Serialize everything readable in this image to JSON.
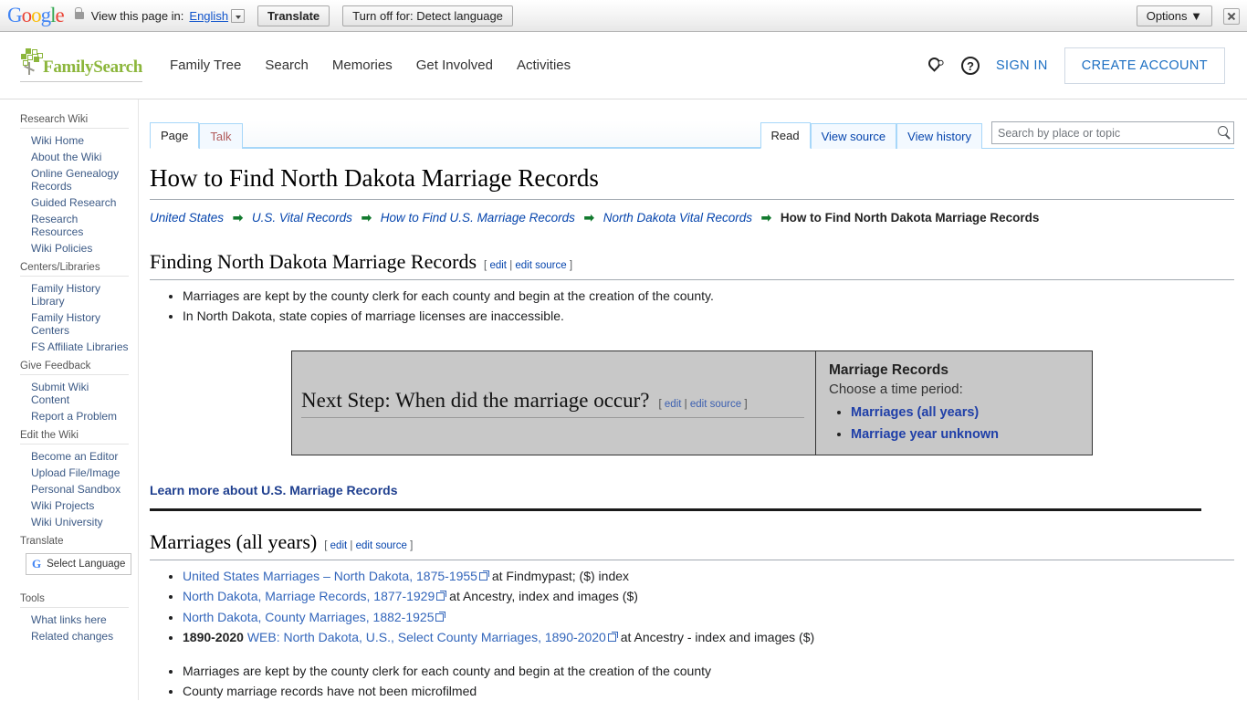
{
  "translate_bar": {
    "logo": "Google",
    "lock_icon": "lock-icon",
    "label": "View this page in:",
    "language": "English",
    "translate_button": "Translate",
    "turn_off_button": "Turn off for: Detect language",
    "options_button": "Options ▼",
    "close_icon": "close-icon"
  },
  "header": {
    "brand": "FamilySearch",
    "nav": [
      {
        "label": "Family Tree"
      },
      {
        "label": "Search"
      },
      {
        "label": "Memories"
      },
      {
        "label": "Get Involved"
      },
      {
        "label": "Activities"
      }
    ],
    "location_icon": "location-pin-icon",
    "help_icon": "help-circle-icon",
    "help_glyph": "?",
    "sign_in": "SIGN IN",
    "create_account": "CREATE ACCOUNT"
  },
  "sidebar": {
    "groups": [
      {
        "heading": "Research Wiki",
        "items": [
          {
            "label": "Wiki Home"
          },
          {
            "label": "About the Wiki"
          },
          {
            "label": "Online Genealogy Records"
          },
          {
            "label": "Guided Research"
          },
          {
            "label": "Research Resources"
          },
          {
            "label": "Wiki Policies"
          }
        ]
      },
      {
        "heading": "Centers/Libraries",
        "items": [
          {
            "label": "Family History Library"
          },
          {
            "label": "Family History Centers"
          },
          {
            "label": "FS Affiliate Libraries"
          }
        ]
      },
      {
        "heading": "Give Feedback",
        "items": [
          {
            "label": "Submit Wiki Content"
          },
          {
            "label": "Report a Problem"
          }
        ]
      },
      {
        "heading": "Edit the Wiki",
        "items": [
          {
            "label": "Become an Editor"
          },
          {
            "label": "Upload File/Image"
          },
          {
            "label": "Personal Sandbox"
          },
          {
            "label": "Wiki Projects"
          },
          {
            "label": "Wiki University"
          }
        ]
      }
    ],
    "translate_heading": "Translate",
    "select_language": "Select Language",
    "google_g": "G",
    "tools_heading": "Tools",
    "tools": [
      {
        "label": "What links here"
      },
      {
        "label": "Related changes"
      }
    ]
  },
  "tabs": {
    "left": [
      {
        "label": "Page",
        "selected": true
      },
      {
        "label": "Talk",
        "selected": false
      }
    ],
    "right": [
      {
        "label": "Read",
        "selected": true
      },
      {
        "label": "View source",
        "selected": false
      },
      {
        "label": "View history",
        "selected": false
      }
    ]
  },
  "search": {
    "placeholder": "Search by place or topic",
    "value": "",
    "icon": "search-icon"
  },
  "page": {
    "title": "How to Find North Dakota Marriage Records",
    "breadcrumb": [
      {
        "label": "United States",
        "current": false
      },
      {
        "label": "U.S. Vital Records",
        "current": false
      },
      {
        "label": "How to Find U.S. Marriage Records",
        "current": false
      },
      {
        "label": "North Dakota Vital Records",
        "current": false
      },
      {
        "label": "How to Find North Dakota Marriage Records",
        "current": true
      }
    ],
    "breadcrumb_arrow": "➡",
    "edit_open": "[",
    "edit_label": "edit",
    "edit_sep": "|",
    "edit_source_label": "edit source",
    "edit_close": "]",
    "section1": {
      "heading": "Finding North Dakota Marriage Records",
      "bullets": [
        "Marriages are kept by the county clerk for each county and begin at the creation of the county.",
        "In North Dakota, state copies of marriage licenses are inaccessible."
      ]
    },
    "next_step": {
      "heading": "Next Step: When did the marriage occur?",
      "box_title": "Marriage Records",
      "box_subtitle": "Choose a time period:",
      "options": [
        {
          "label": "Marriages (all years)"
        },
        {
          "label": "Marriage year unknown"
        }
      ]
    },
    "learn_more": "Learn more about U.S. Marriage Records",
    "section2": {
      "heading": "Marriages (all years)",
      "links": [
        {
          "prefix": "",
          "link": "United States Marriages – North Dakota, 1875-1955",
          "external": true,
          "suffix": " at Findmypast; ($) index"
        },
        {
          "prefix": "",
          "link": "North Dakota, Marriage Records, 1877-1929",
          "external": true,
          "suffix": " at Ancestry, index and images ($)"
        },
        {
          "prefix": "",
          "link": "North Dakota, County Marriages, 1882-1925",
          "external": true,
          "suffix": ""
        },
        {
          "prefix": "1890-2020 ",
          "link": "WEB: North Dakota, U.S., Select County Marriages, 1890-2020",
          "external": true,
          "suffix": " at Ancestry - index and images ($)"
        }
      ],
      "plain_bullets": [
        "Marriages are kept by the county clerk for each county and begin at the creation of the county",
        "County marriage records have not been microfilmed"
      ]
    }
  },
  "colors": {
    "brand_green": "#8cb63c",
    "link_blue": "#0645ad",
    "wiki_link": "#3366bb",
    "fs_blue": "#1b6ec2",
    "arrow_green": "#127a2e",
    "box_gray": "#c8c8c8"
  }
}
